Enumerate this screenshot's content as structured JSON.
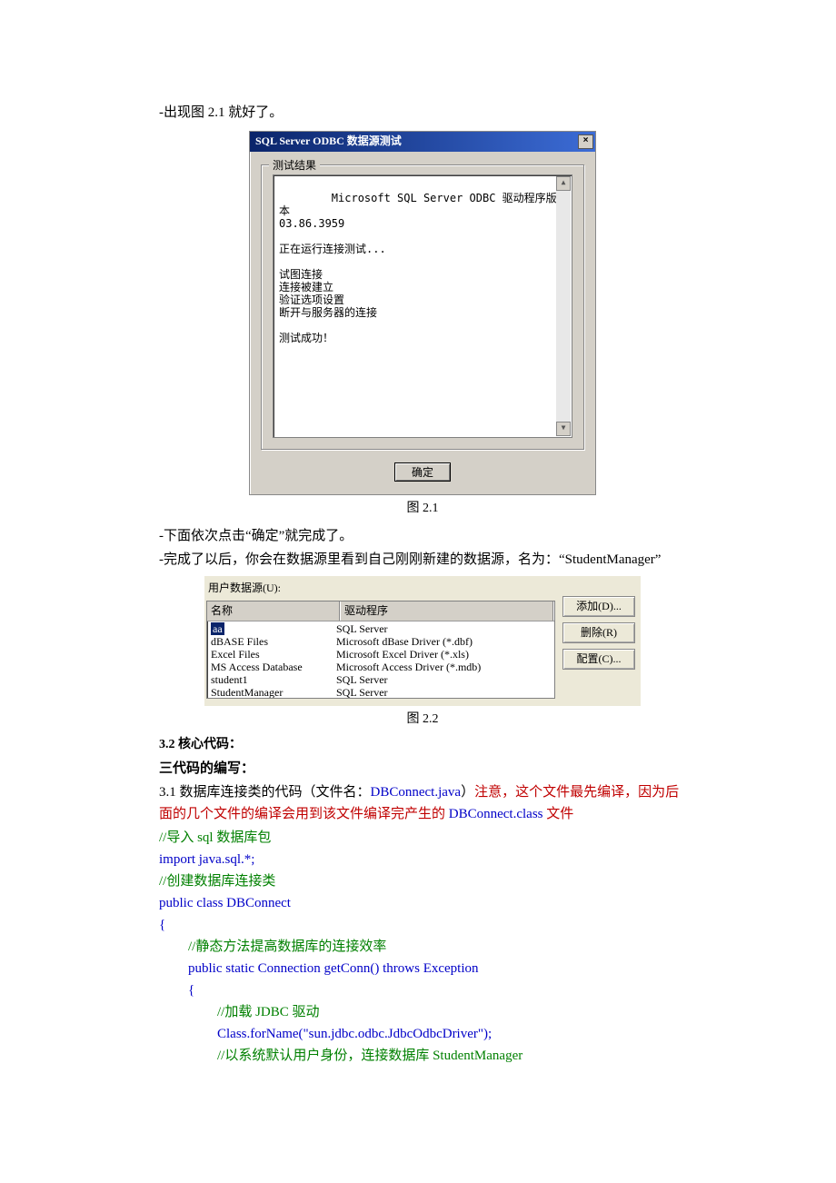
{
  "text": {
    "line1": "-出现图 2.1 就好了。",
    "caption1": "图 2.1",
    "line2": "-下面依次点击“确定”就完成了。",
    "line3": "-完成了以后，你会在数据源里看到自己刚刚新建的数据源，名为：“StudentManager”",
    "caption2": "图 2.2",
    "sec32": "3.2 核心代码：",
    "sub3": "三代码的编写：",
    "p31a": "3.1 数据库连接类的代码（文件名：",
    "p31b": "DBConnect.java",
    "p31c": "）",
    "p31d": "注意，这个文件最先编译，因为后面的几个文件的编译会用到该文件编译完产生的 ",
    "p31e": "DBConnect.class",
    "p31f": " 文件"
  },
  "dialog": {
    "title": "SQL Server ODBC 数据源测试",
    "groupbox_label": "测试结果",
    "results": "Microsoft SQL Server ODBC 驱动程序版本\n03.86.3959\n\n正在运行连接测试...\n\n试图连接\n连接被建立\n验证选项设置\n断开与服务器的连接\n\n测试成功！",
    "ok": "确定"
  },
  "ds": {
    "label": "用户数据源(U):",
    "hdr_name": "名称",
    "hdr_drv": "驱动程序",
    "rows": [
      {
        "name": "aa",
        "drv": "SQL Server",
        "selected": true
      },
      {
        "name": "dBASE Files",
        "drv": "Microsoft dBase Driver (*.dbf)"
      },
      {
        "name": "Excel Files",
        "drv": "Microsoft Excel Driver (*.xls)"
      },
      {
        "name": "MS Access Database",
        "drv": "Microsoft Access Driver (*.mdb)"
      },
      {
        "name": "student1",
        "drv": "SQL Server"
      },
      {
        "name": "StudentManager",
        "drv": "SQL Server"
      }
    ],
    "btn_add": "添加(D)...",
    "btn_del": "删除(R)",
    "btn_cfg": "配置(C)..."
  },
  "code": {
    "c1": "//导入 sql 数据库包",
    "l1": "import java.sql.*;",
    "c2": "//创建数据库连接类",
    "l2": "public class DBConnect",
    "l3": "{",
    "c3": "//静态方法提高数据库的连接效率",
    "l4": "public static Connection getConn() throws Exception",
    "l5": "{",
    "c4": "//加载 JDBC 驱动",
    "l6": "Class.forName(\"sun.jdbc.odbc.JdbcOdbcDriver\");",
    "c5": "//以系统默认用户身份，连接数据库 StudentManager"
  }
}
